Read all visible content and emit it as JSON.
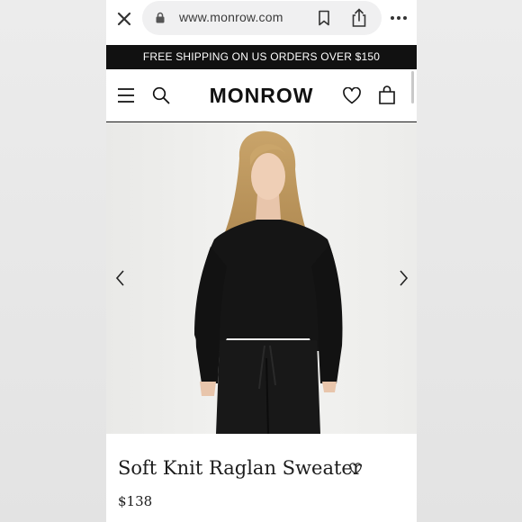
{
  "browser": {
    "url": "www.monrow.com",
    "icons": [
      "close-icon",
      "lock-icon",
      "bookmark-icon",
      "share-icon",
      "more-icon"
    ]
  },
  "promo_banner": {
    "text": "FREE SHIPPING ON US ORDERS OVER $150"
  },
  "header": {
    "logo": "MONROW",
    "icons": [
      "menu-icon",
      "search-icon",
      "heart-icon",
      "bag-icon"
    ]
  },
  "product": {
    "title": "Soft Knit Raglan Sweater",
    "price": "$138",
    "gallery_nav": [
      "chevron-left-icon",
      "chevron-right-icon"
    ]
  },
  "colors": {
    "banner_bg": "#111111",
    "text": "#1c1c1c",
    "url_pill": "#f0f0f1",
    "photo_bg": "#efefed",
    "sweater": "#141414"
  }
}
